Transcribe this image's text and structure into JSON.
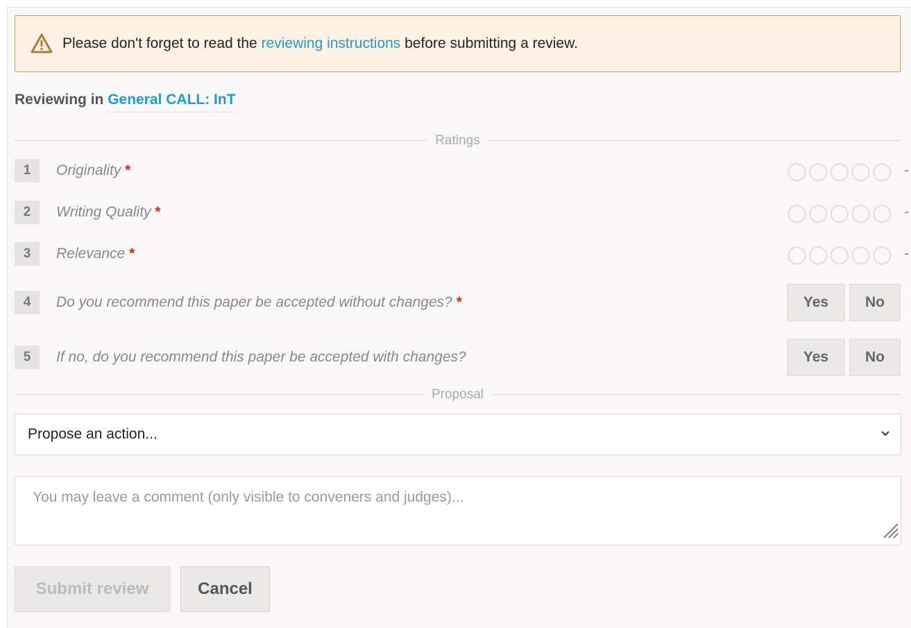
{
  "notice": {
    "before_link": "Please don't forget to read the ",
    "link_text": "reviewing instructions",
    "after_link": " before submitting a review."
  },
  "reviewing": {
    "prefix": "Reviewing in",
    "track": "General CALL: InT"
  },
  "ratings_divider": "Ratings",
  "proposal_divider": "Proposal",
  "questions": [
    {
      "num": "1",
      "text": "Originality",
      "required": "*",
      "control": "stars",
      "stars": "○○○○○",
      "value": "-"
    },
    {
      "num": "2",
      "text": "Writing Quality",
      "required": "*",
      "control": "stars",
      "stars": "○○○○○",
      "value": "-"
    },
    {
      "num": "3",
      "text": "Relevance",
      "required": "*",
      "control": "stars",
      "stars": "○○○○○",
      "value": "-"
    },
    {
      "num": "4",
      "text": "Do you recommend this paper be accepted without changes?",
      "required": "*",
      "control": "yesno",
      "yes": "Yes",
      "no": "No"
    },
    {
      "num": "5",
      "text": "If no, do you recommend this paper be accepted with changes?",
      "required": "",
      "control": "yesno",
      "yes": "Yes",
      "no": "No"
    }
  ],
  "proposal": {
    "selected": "Propose an action..."
  },
  "comment": {
    "placeholder": "You may leave a comment (only visible to conveners and judges)..."
  },
  "actions": {
    "submit": "Submit review",
    "cancel": "Cancel"
  },
  "colors": {
    "link": "#1f9bd1",
    "required": "#d12b2b",
    "warning_bg": "#fdf2e3",
    "warning_border": "#c79a5a"
  }
}
